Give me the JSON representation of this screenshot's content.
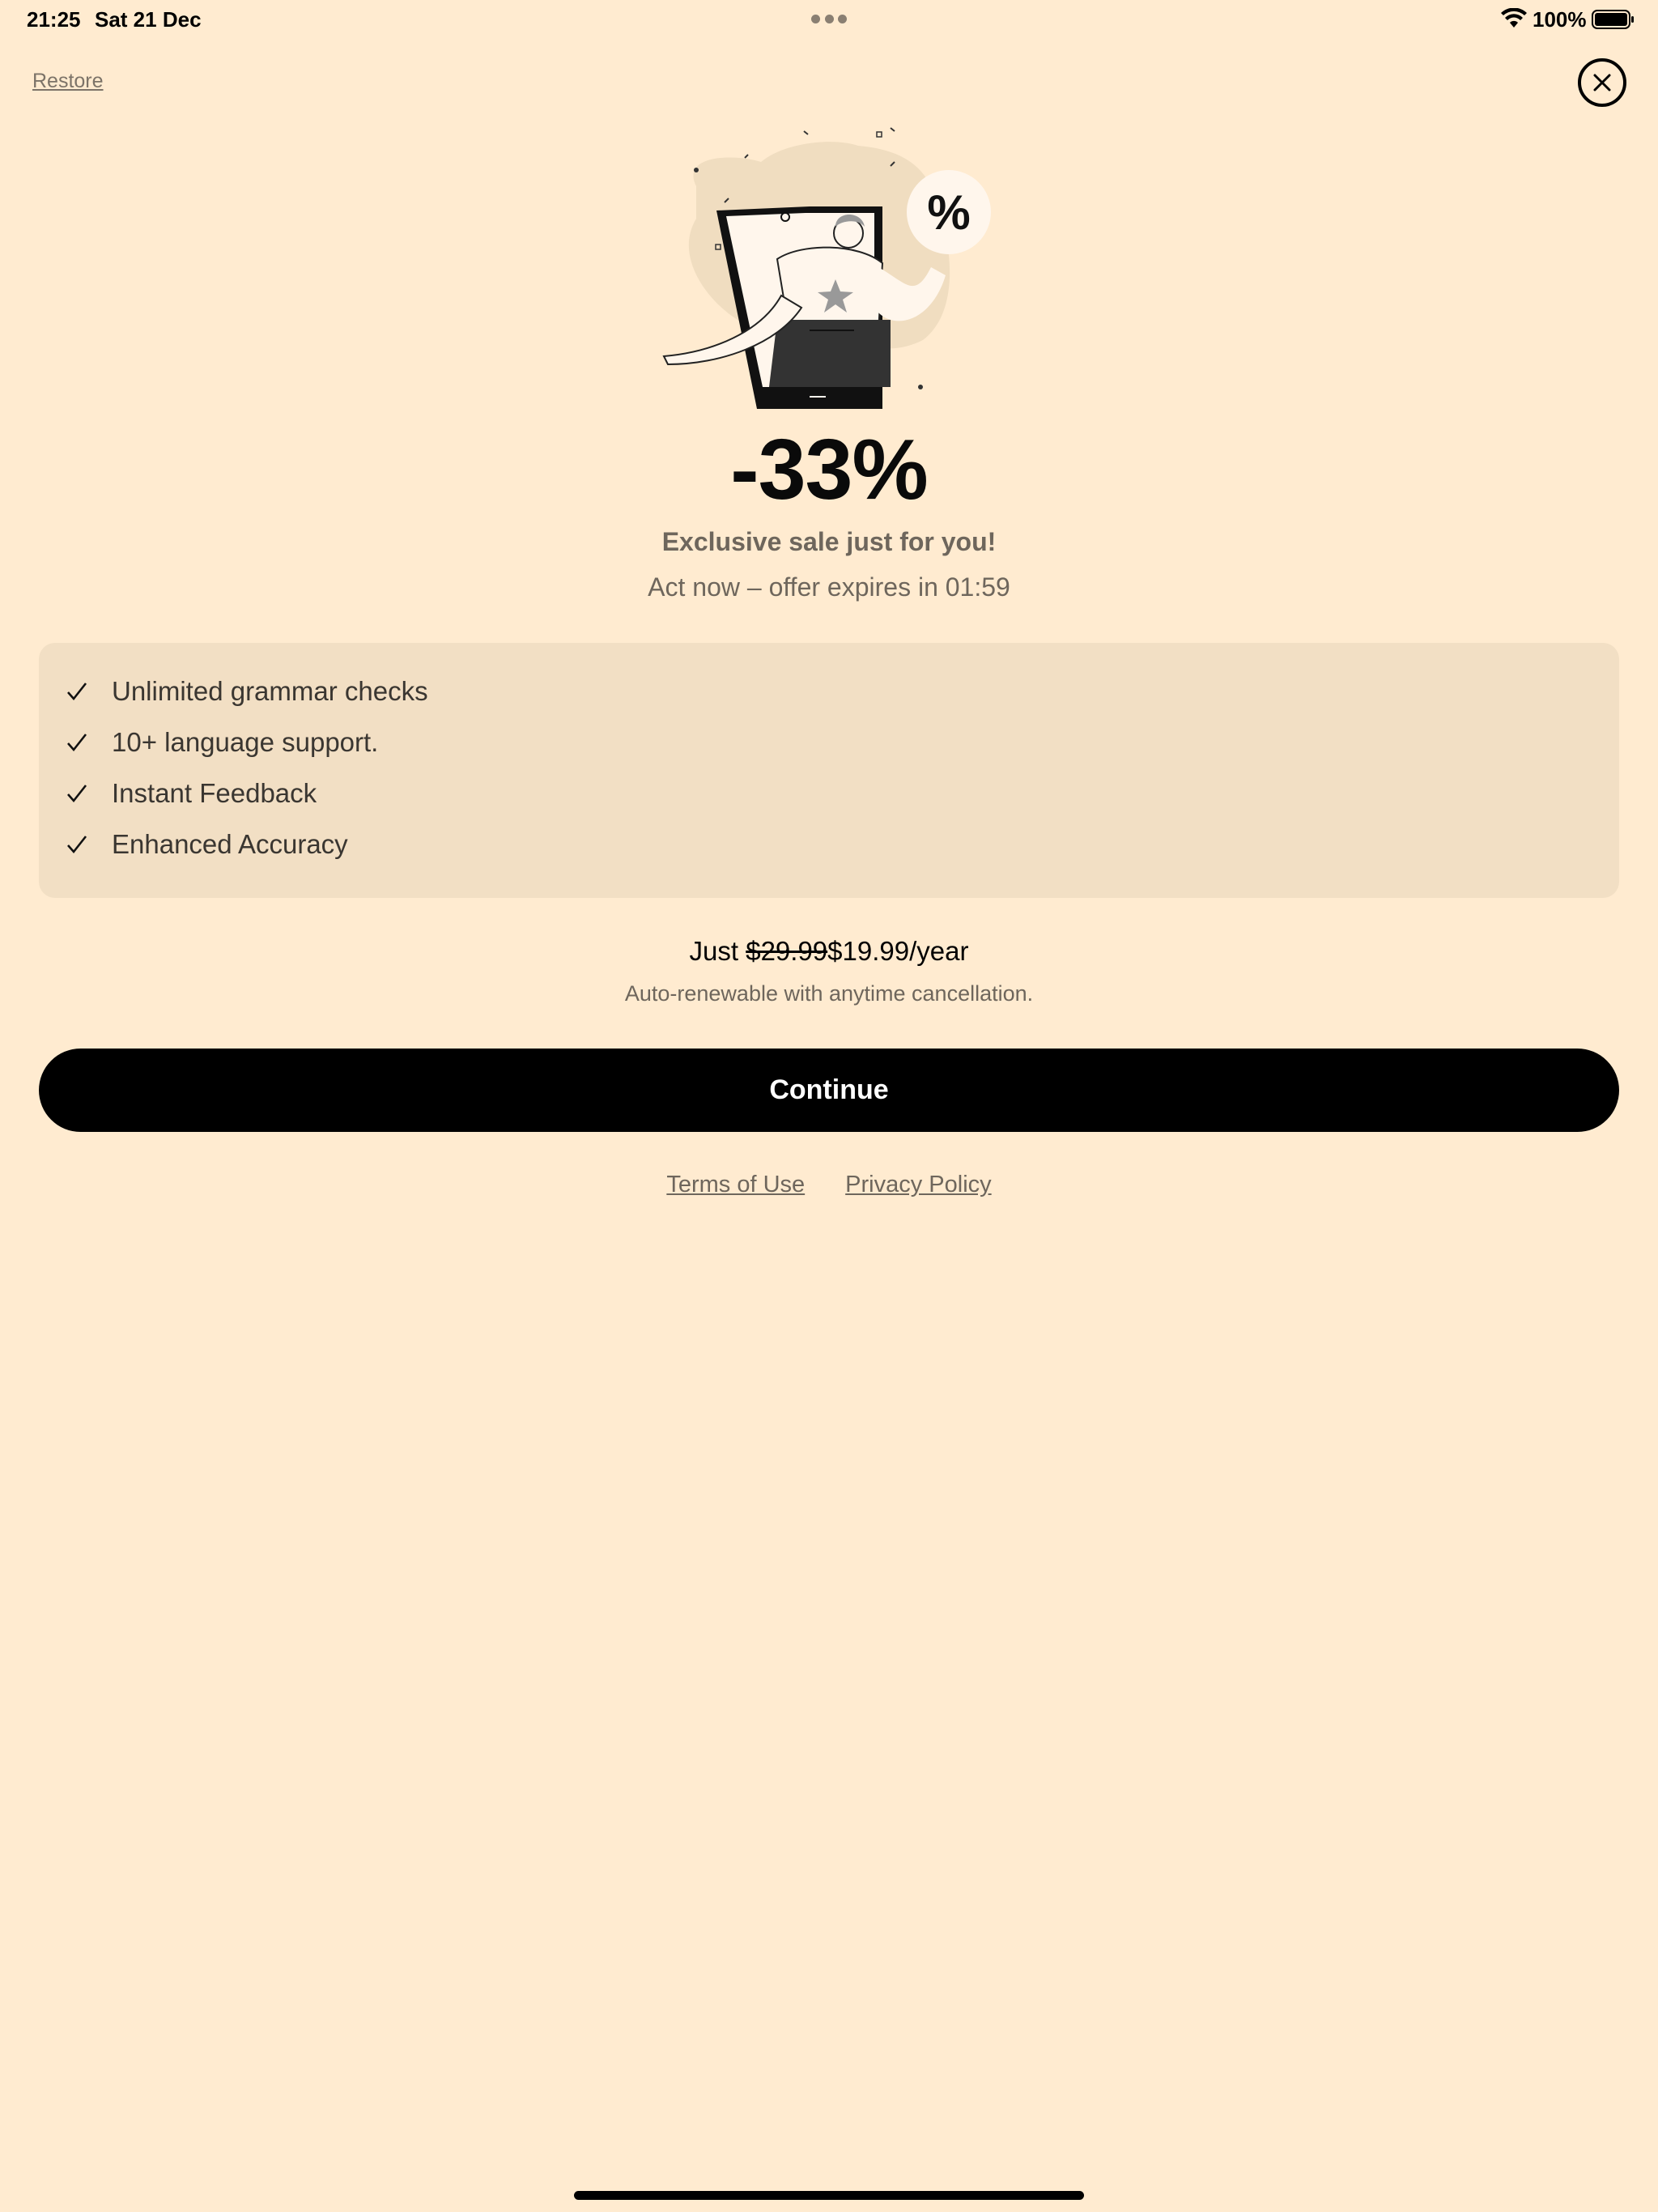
{
  "status_bar": {
    "time": "21:25",
    "date": "Sat 21 Dec",
    "battery_percent": "100%",
    "icons": [
      "wifi-icon",
      "battery-icon",
      "multitask-dots-icon"
    ]
  },
  "header": {
    "restore_label": "Restore",
    "close_icon": "close-icon"
  },
  "hero": {
    "illustration": "person-with-phone-discount-illustration",
    "discount": "-33%",
    "subtitle": "Exclusive sale just for you!",
    "countdown": "Act now – offer expires in 01:59"
  },
  "features": {
    "items": [
      {
        "label": "Unlimited grammar checks"
      },
      {
        "label": "10+ language support."
      },
      {
        "label": "Instant Feedback"
      },
      {
        "label": "Enhanced Accuracy"
      }
    ],
    "icon": "checkmark-icon"
  },
  "pricing": {
    "prefix": "Just ",
    "old_price": "$29.99",
    "new_price": "$19.99/year",
    "note": "Auto-renewable with anytime cancellation."
  },
  "cta": {
    "continue_label": "Continue"
  },
  "legal": {
    "terms_label": "Terms of Use",
    "privacy_label": "Privacy Policy"
  },
  "colors": {
    "background": "#FFEBD0",
    "card": "#F2DFC4",
    "button": "#000000",
    "muted_text": "#6E665C"
  }
}
